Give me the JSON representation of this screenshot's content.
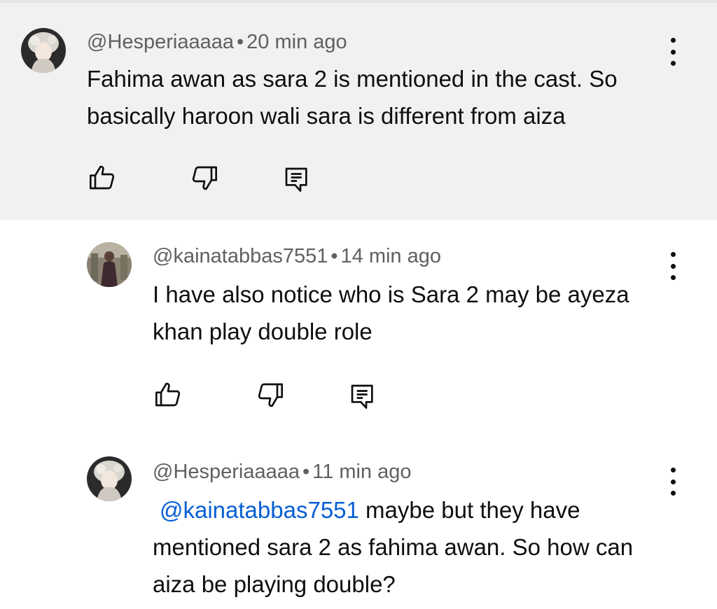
{
  "comments": [
    {
      "author": "@Hesperiaaaaa",
      "separator": "•",
      "time": "20 min ago",
      "text": "Fahima awan as sara 2 is mentioned in the cast. So basically haroon wali sara is different from aiza",
      "highlighted": true
    },
    {
      "author": "@kainatabbas7551",
      "separator": "•",
      "time": "14 min ago",
      "text": "I have also notice who is Sara 2 may be ayeza khan play double role"
    },
    {
      "author": "@Hesperiaaaaa",
      "separator": "•",
      "time": "11 min ago",
      "mention": "@kainatabbas7551",
      "text": " maybe but they have mentioned sara 2 as fahima awan. So how can aiza be playing double?"
    }
  ],
  "icons": {
    "like": "thumb-up-icon",
    "dislike": "thumb-down-icon",
    "reply": "reply-comment-icon",
    "more": "more-vert-icon"
  },
  "colors": {
    "highlight_bg": "#f1f1f1",
    "mention": "#065fd4",
    "meta": "#606060",
    "text": "#0f0f0f"
  }
}
